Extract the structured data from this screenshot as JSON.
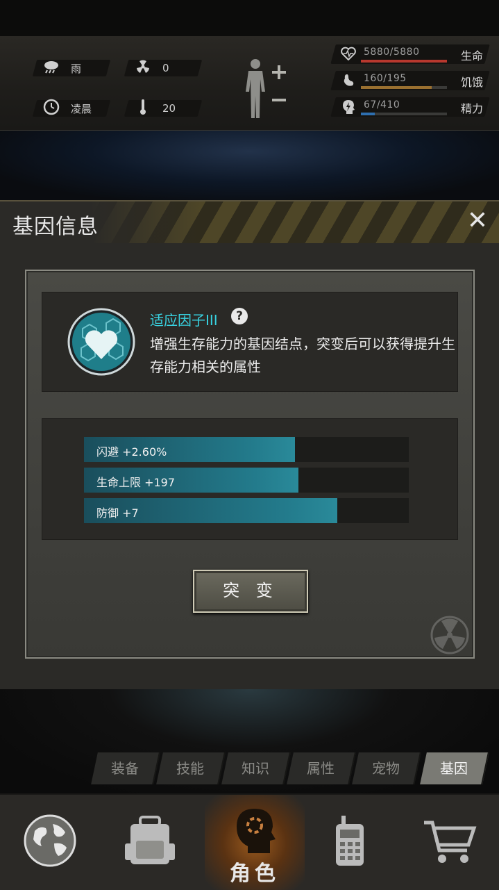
{
  "status_bar": {
    "weather": {
      "icon": "rain-cloud-icon",
      "label": "雨"
    },
    "radiation": {
      "icon": "radiation-icon",
      "value": "0"
    },
    "time": {
      "icon": "clock-icon",
      "label": "凌晨"
    },
    "temperature": {
      "icon": "thermometer-icon",
      "value": "20"
    },
    "stats": [
      {
        "icon": "heart-icon",
        "value": "5880/5880",
        "name": "生命",
        "fill": 1.0,
        "color": "#b8382e"
      },
      {
        "icon": "stomach-icon",
        "value": "160/195",
        "name": "饥饿",
        "fill": 0.82,
        "color": "#9a7030"
      },
      {
        "icon": "energy-head-icon",
        "value": "67/410",
        "name": "精力",
        "fill": 0.16,
        "color": "#2e6fb0"
      }
    ]
  },
  "dialog": {
    "title": "基因信息",
    "gene": {
      "icon": "heart-hex-gene-icon",
      "name": "适应因子III",
      "description": "增强生存能力的基因结点，突变后可以获得提升生存能力相关的属性"
    },
    "attributes": [
      {
        "label": "闪避 +2.60%",
        "fill": 0.65
      },
      {
        "label": "生命上限 +197",
        "fill": 0.66
      },
      {
        "label": "防御 +7",
        "fill": 0.78
      }
    ],
    "mutate_button": "突 变"
  },
  "tabs": [
    {
      "label": "装备",
      "active": false
    },
    {
      "label": "技能",
      "active": false
    },
    {
      "label": "知识",
      "active": false
    },
    {
      "label": "属性",
      "active": false
    },
    {
      "label": "宠物",
      "active": false
    },
    {
      "label": "基因",
      "active": true
    }
  ],
  "bottom_nav": [
    {
      "icon": "globe-icon",
      "label": "",
      "active": false
    },
    {
      "icon": "backpack-icon",
      "label": "",
      "active": false
    },
    {
      "icon": "character-head-icon",
      "label": "角色",
      "active": true
    },
    {
      "icon": "walkie-talkie-icon",
      "label": "",
      "active": false
    },
    {
      "icon": "shopping-cart-icon",
      "label": "",
      "active": false
    }
  ]
}
